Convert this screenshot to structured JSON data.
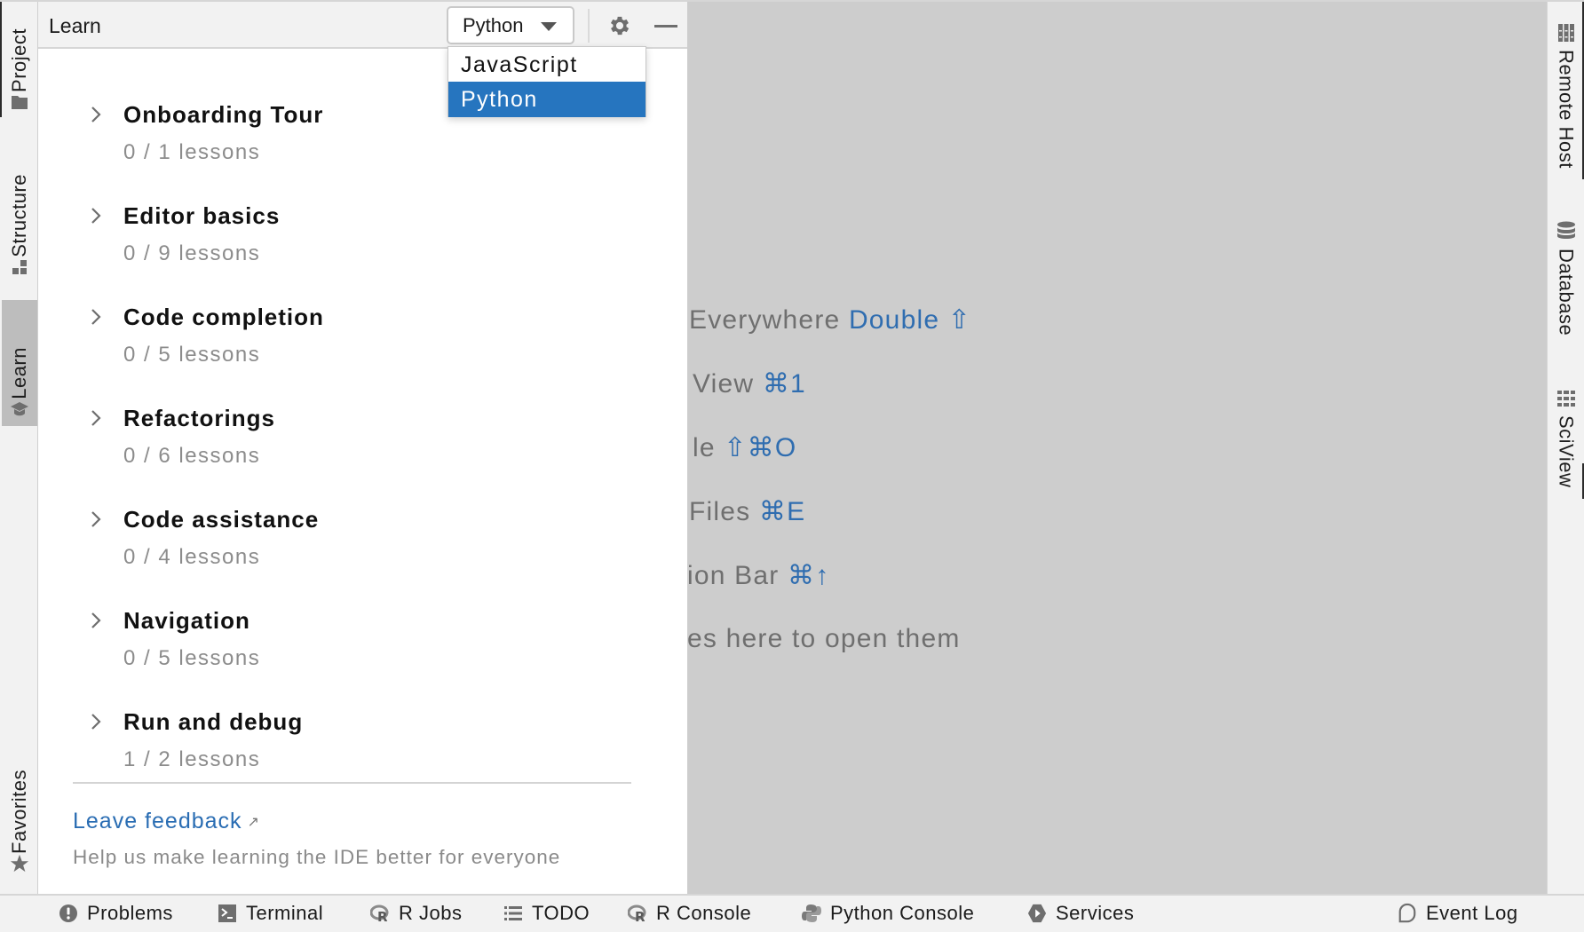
{
  "left_stripe": {
    "tabs": [
      {
        "label": "Project",
        "icon": "folder-icon",
        "selected": false
      },
      {
        "label": "Structure",
        "icon": "structure-icon",
        "selected": false
      },
      {
        "label": "Learn",
        "icon": "graduation-cap-icon",
        "selected": true
      },
      {
        "label": "Favorites",
        "icon": "star-icon",
        "selected": false
      }
    ]
  },
  "learn_panel": {
    "title": "Learn",
    "language_select": {
      "value": "Python",
      "options": [
        "JavaScript",
        "Python"
      ],
      "selected_index": 1
    },
    "gear_icon": "gear-icon",
    "minimize_icon": "minimize-icon",
    "courses": [
      {
        "name": "Onboarding Tour",
        "progress": "0 / 1 lessons",
        "completed": 0,
        "total": 1
      },
      {
        "name": "Editor basics",
        "progress": "0 / 9 lessons",
        "completed": 0,
        "total": 9
      },
      {
        "name": "Code completion",
        "progress": "0 / 5 lessons",
        "completed": 0,
        "total": 5
      },
      {
        "name": "Refactorings",
        "progress": "0 / 6 lessons",
        "completed": 0,
        "total": 6
      },
      {
        "name": "Code assistance",
        "progress": "0 / 4 lessons",
        "completed": 0,
        "total": 4
      },
      {
        "name": "Navigation",
        "progress": "0 / 5 lessons",
        "completed": 0,
        "total": 5
      },
      {
        "name": "Run and debug",
        "progress": "1 / 2 lessons",
        "completed": 1,
        "total": 2
      }
    ],
    "feedback": {
      "link_label": "Leave feedback",
      "link_icon": "external-link-icon",
      "subtitle": "Help us make learning the IDE better for everyone"
    }
  },
  "editor_hints": [
    {
      "text": "Everywhere ",
      "shortcut": "Double ⇧"
    },
    {
      "text": "View ",
      "shortcut": "⌘1"
    },
    {
      "text": "le ",
      "shortcut": "⇧⌘O"
    },
    {
      "text": "Files ",
      "shortcut": "⌘E"
    },
    {
      "text": "ion Bar ",
      "shortcut": "⌘↑"
    },
    {
      "text": "es here to open them",
      "shortcut": ""
    }
  ],
  "right_stripe": {
    "tabs": [
      {
        "label": "Remote Host",
        "icon": "server-icon"
      },
      {
        "label": "Database",
        "icon": "database-icon"
      },
      {
        "label": "SciView",
        "icon": "grid-icon"
      }
    ]
  },
  "status_bar": {
    "items": [
      {
        "label": "Problems",
        "icon": "warning-icon"
      },
      {
        "label": "Terminal",
        "icon": "terminal-icon"
      },
      {
        "label": "R Jobs",
        "icon": "r-icon"
      },
      {
        "label": "TODO",
        "icon": "list-icon"
      },
      {
        "label": "R Console",
        "icon": "r-icon"
      },
      {
        "label": "Python Console",
        "icon": "python-icon"
      },
      {
        "label": "Services",
        "icon": "services-icon"
      }
    ],
    "event_log": {
      "label": "Event Log",
      "icon": "speech-bubble-icon"
    }
  },
  "colors": {
    "accent": "#2675BF",
    "link": "#2A6DB3",
    "shortcut": "#2F6DB0",
    "editor_bg": "#CDCDCD",
    "selected_tab_bg": "#BDBDBD"
  }
}
